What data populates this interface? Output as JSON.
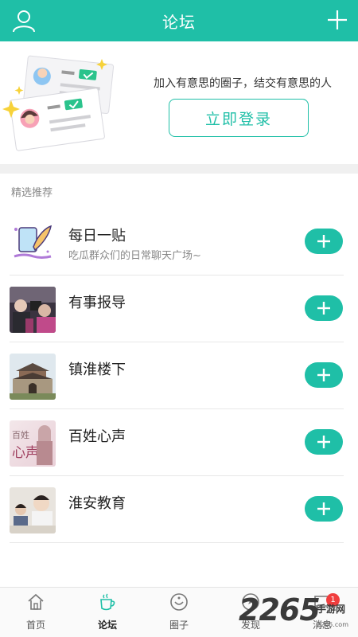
{
  "header": {
    "title": "论坛",
    "bg_color": "#1fbfa7"
  },
  "banner": {
    "tagline": "加入有意思的圈子，结交有意思的人",
    "login_label": "立即登录"
  },
  "section": {
    "title": "精选推荐"
  },
  "forums": [
    {
      "name": "每日一贴",
      "desc": "吃瓜群众们的日常聊天广场~",
      "thumb_icon": "feather-pen-icon"
    },
    {
      "name": "有事报导",
      "desc": "",
      "thumb_icon": "reporters-photo"
    },
    {
      "name": "镇淮楼下",
      "desc": "",
      "thumb_icon": "tower-photo"
    },
    {
      "name": "百姓心声",
      "desc": "",
      "thumb_icon": "voice-photo",
      "thumb_text_top": "百姓",
      "thumb_text_bottom": "心声"
    },
    {
      "name": "淮安教育",
      "desc": "",
      "thumb_icon": "education-photo"
    }
  ],
  "tabbar": {
    "tabs": [
      {
        "label": "首页",
        "icon": "home-icon"
      },
      {
        "label": "论坛",
        "icon": "coffee-cup-icon",
        "active": true
      },
      {
        "label": "圈子",
        "icon": "smile-circle-icon"
      },
      {
        "label": "发现",
        "icon": "discover-icon"
      },
      {
        "label": "消息",
        "icon": "message-icon",
        "badge": "1"
      }
    ]
  },
  "watermark": {
    "brand": "2265",
    "suffix": "手游网",
    "url": "2265.com"
  },
  "colors": {
    "accent": "#1fbfa7",
    "badge": "#f03e3e"
  }
}
